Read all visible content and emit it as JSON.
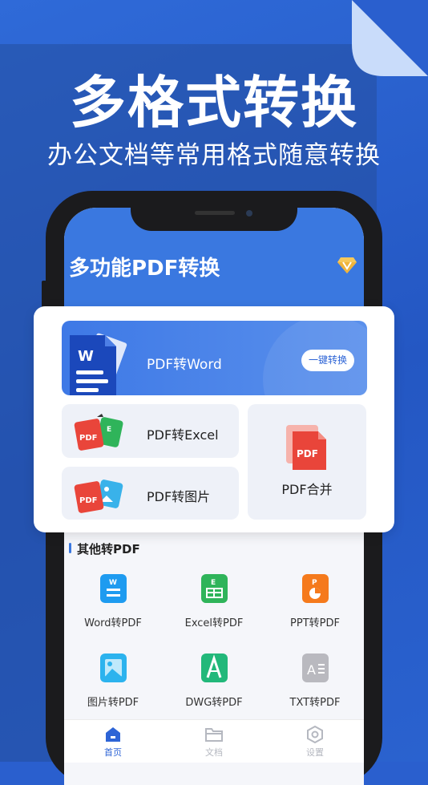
{
  "hero": {
    "title": "多格式转换",
    "subtitle": "办公文档等常用格式随意转换"
  },
  "app": {
    "title": "多功能PDF转换",
    "vip_icon": "diamond-icon"
  },
  "main_features": {
    "pdf_to_word": {
      "label": "PDF转Word",
      "button": "一键转换",
      "icon": "word-doc-icon"
    },
    "pdf_to_excel": {
      "label": "PDF转Excel",
      "icon": "pdf-excel-icon"
    },
    "pdf_to_image": {
      "label": "PDF转图片",
      "icon": "pdf-image-icon"
    },
    "pdf_merge": {
      "label": "PDF合并",
      "icon": "pdf-stack-icon"
    }
  },
  "other_section": {
    "title": "其他转PDF",
    "items": [
      {
        "label": "Word转PDF",
        "icon": "word-icon",
        "color": "#1e9bf0"
      },
      {
        "label": "Excel转PDF",
        "icon": "excel-icon",
        "color": "#2fb45a"
      },
      {
        "label": "PPT转PDF",
        "icon": "ppt-icon",
        "color": "#f57a1c"
      },
      {
        "label": "图片转PDF",
        "icon": "image-icon",
        "color": "#2cb3ee"
      },
      {
        "label": "DWG转PDF",
        "icon": "dwg-icon",
        "color": "#22b87a"
      },
      {
        "label": "TXT转PDF",
        "icon": "txt-icon",
        "color": "#b9b9bf"
      }
    ]
  },
  "tabs": [
    {
      "label": "首页",
      "icon": "home-icon",
      "active": true
    },
    {
      "label": "文档",
      "icon": "folder-icon",
      "active": false
    },
    {
      "label": "设置",
      "icon": "settings-icon",
      "active": false
    }
  ],
  "colors": {
    "brand": "#3a78e0",
    "background": "#2a5fce"
  }
}
